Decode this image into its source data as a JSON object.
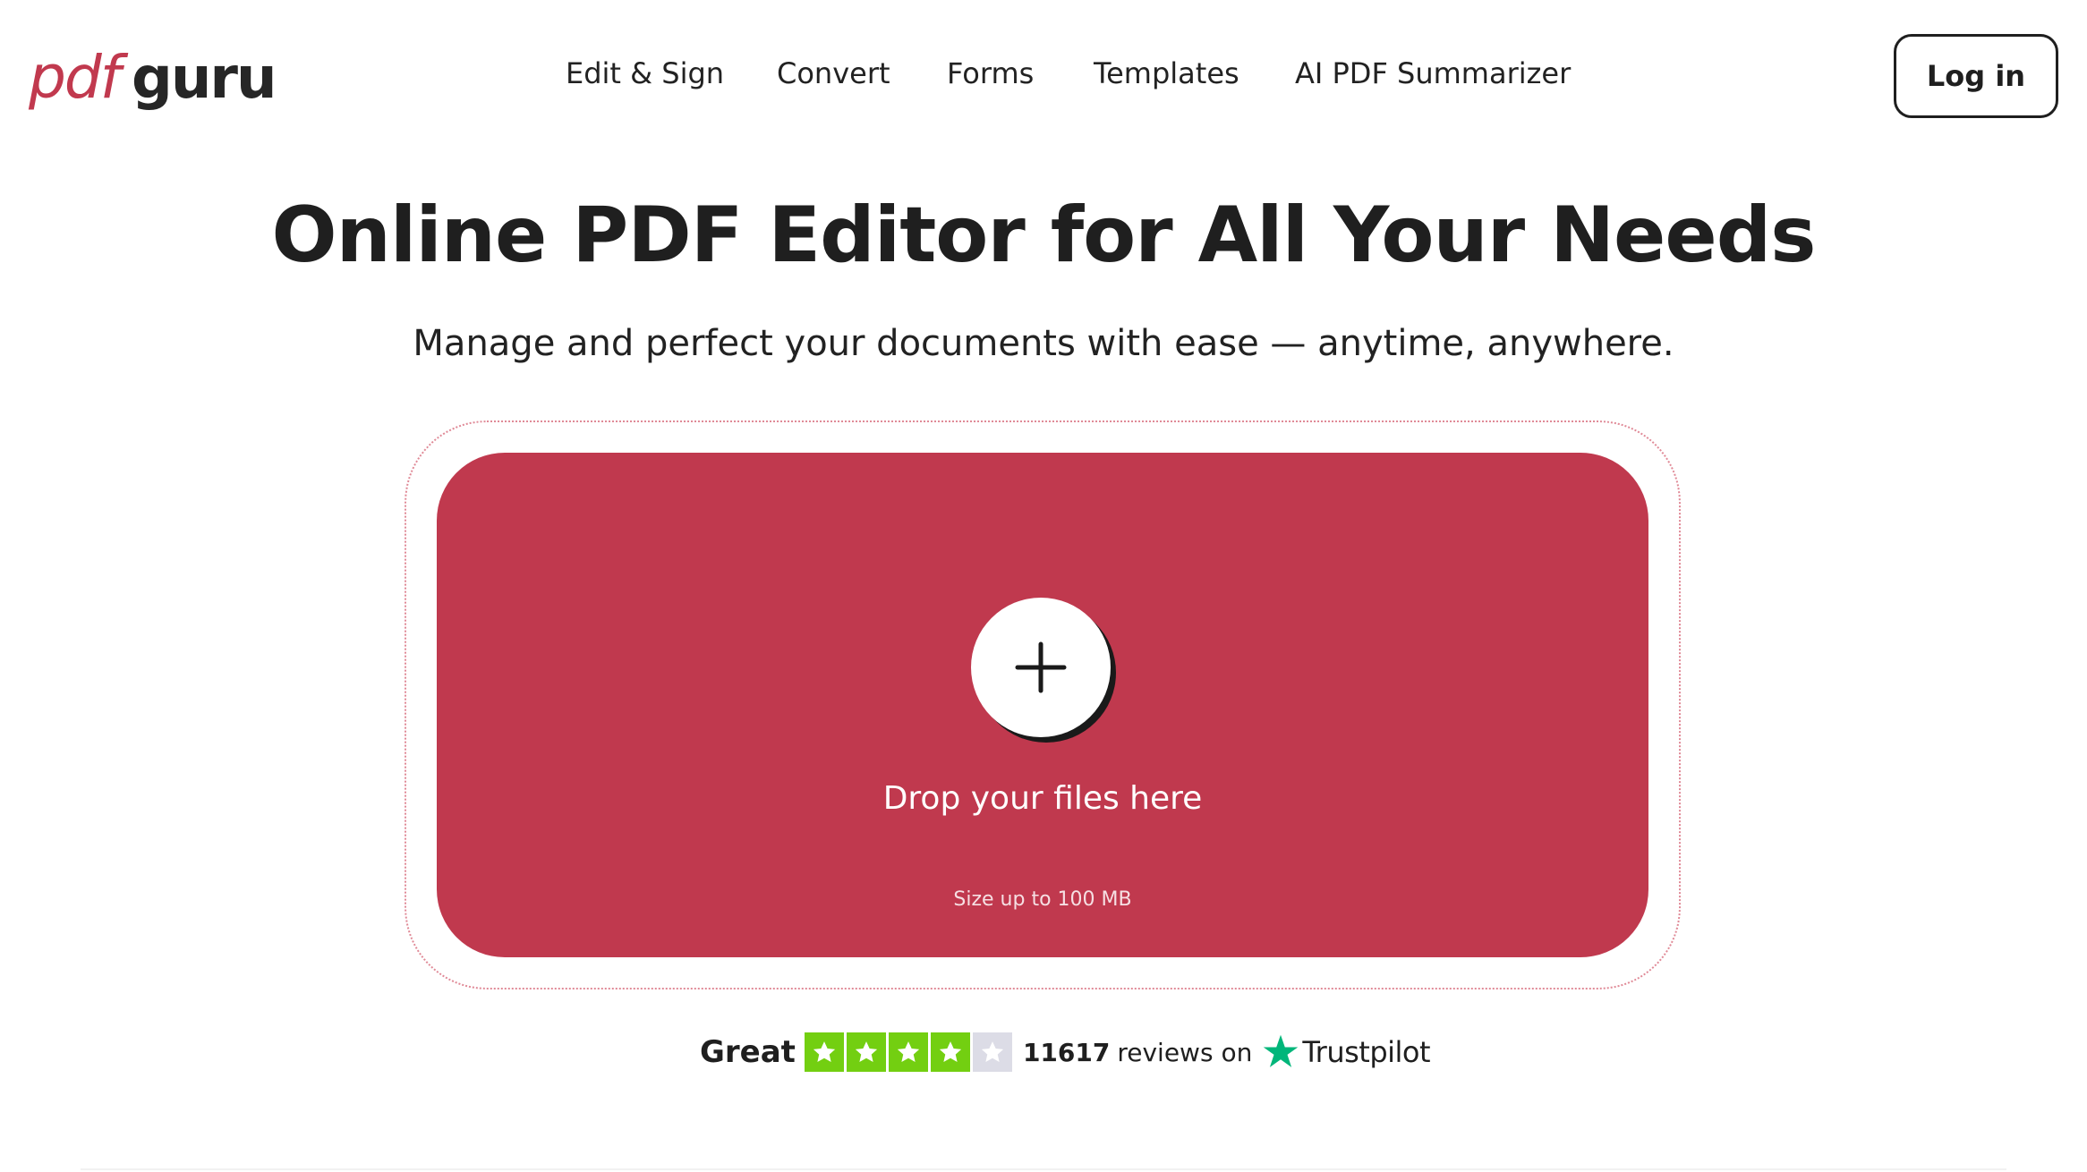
{
  "brand": {
    "logo_part1": "pdf",
    "logo_part2": "guru",
    "accent_color": "#c0394e"
  },
  "nav": {
    "items": [
      {
        "label": "Edit & Sign"
      },
      {
        "label": "Convert"
      },
      {
        "label": "Forms"
      },
      {
        "label": "Templates"
      },
      {
        "label": "AI PDF Summarizer"
      }
    ],
    "login_label": "Log in"
  },
  "hero": {
    "title": "Online PDF Editor for All Your Needs",
    "subtitle": "Manage and perfect your documents with ease — anytime, anywhere."
  },
  "dropzone": {
    "icon": "plus-icon",
    "label": "Drop your files here",
    "size_limit": "Size up to 100 MB"
  },
  "trustpilot": {
    "rating_word": "Great",
    "stars_filled": 4,
    "stars_total": 5,
    "review_count": "11617",
    "reviews_on": "reviews on",
    "brand": "Trustpilot",
    "star_color": "#73cf11",
    "logo_color": "#00b67a"
  }
}
